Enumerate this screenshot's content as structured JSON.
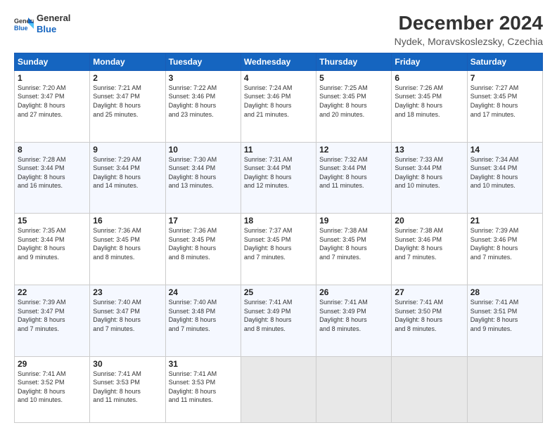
{
  "logo": {
    "line1": "General",
    "line2": "Blue"
  },
  "title": "December 2024",
  "subtitle": "Nydek, Moravskoslezsky, Czechia",
  "days_header": [
    "Sunday",
    "Monday",
    "Tuesday",
    "Wednesday",
    "Thursday",
    "Friday",
    "Saturday"
  ],
  "weeks": [
    [
      {
        "day": "1",
        "info": "Sunrise: 7:20 AM\nSunset: 3:47 PM\nDaylight: 8 hours\nand 27 minutes."
      },
      {
        "day": "2",
        "info": "Sunrise: 7:21 AM\nSunset: 3:47 PM\nDaylight: 8 hours\nand 25 minutes."
      },
      {
        "day": "3",
        "info": "Sunrise: 7:22 AM\nSunset: 3:46 PM\nDaylight: 8 hours\nand 23 minutes."
      },
      {
        "day": "4",
        "info": "Sunrise: 7:24 AM\nSunset: 3:46 PM\nDaylight: 8 hours\nand 21 minutes."
      },
      {
        "day": "5",
        "info": "Sunrise: 7:25 AM\nSunset: 3:45 PM\nDaylight: 8 hours\nand 20 minutes."
      },
      {
        "day": "6",
        "info": "Sunrise: 7:26 AM\nSunset: 3:45 PM\nDaylight: 8 hours\nand 18 minutes."
      },
      {
        "day": "7",
        "info": "Sunrise: 7:27 AM\nSunset: 3:45 PM\nDaylight: 8 hours\nand 17 minutes."
      }
    ],
    [
      {
        "day": "8",
        "info": "Sunrise: 7:28 AM\nSunset: 3:44 PM\nDaylight: 8 hours\nand 16 minutes."
      },
      {
        "day": "9",
        "info": "Sunrise: 7:29 AM\nSunset: 3:44 PM\nDaylight: 8 hours\nand 14 minutes."
      },
      {
        "day": "10",
        "info": "Sunrise: 7:30 AM\nSunset: 3:44 PM\nDaylight: 8 hours\nand 13 minutes."
      },
      {
        "day": "11",
        "info": "Sunrise: 7:31 AM\nSunset: 3:44 PM\nDaylight: 8 hours\nand 12 minutes."
      },
      {
        "day": "12",
        "info": "Sunrise: 7:32 AM\nSunset: 3:44 PM\nDaylight: 8 hours\nand 11 minutes."
      },
      {
        "day": "13",
        "info": "Sunrise: 7:33 AM\nSunset: 3:44 PM\nDaylight: 8 hours\nand 10 minutes."
      },
      {
        "day": "14",
        "info": "Sunrise: 7:34 AM\nSunset: 3:44 PM\nDaylight: 8 hours\nand 10 minutes."
      }
    ],
    [
      {
        "day": "15",
        "info": "Sunrise: 7:35 AM\nSunset: 3:44 PM\nDaylight: 8 hours\nand 9 minutes."
      },
      {
        "day": "16",
        "info": "Sunrise: 7:36 AM\nSunset: 3:45 PM\nDaylight: 8 hours\nand 8 minutes."
      },
      {
        "day": "17",
        "info": "Sunrise: 7:36 AM\nSunset: 3:45 PM\nDaylight: 8 hours\nand 8 minutes."
      },
      {
        "day": "18",
        "info": "Sunrise: 7:37 AM\nSunset: 3:45 PM\nDaylight: 8 hours\nand 7 minutes."
      },
      {
        "day": "19",
        "info": "Sunrise: 7:38 AM\nSunset: 3:45 PM\nDaylight: 8 hours\nand 7 minutes."
      },
      {
        "day": "20",
        "info": "Sunrise: 7:38 AM\nSunset: 3:46 PM\nDaylight: 8 hours\nand 7 minutes."
      },
      {
        "day": "21",
        "info": "Sunrise: 7:39 AM\nSunset: 3:46 PM\nDaylight: 8 hours\nand 7 minutes."
      }
    ],
    [
      {
        "day": "22",
        "info": "Sunrise: 7:39 AM\nSunset: 3:47 PM\nDaylight: 8 hours\nand 7 minutes."
      },
      {
        "day": "23",
        "info": "Sunrise: 7:40 AM\nSunset: 3:47 PM\nDaylight: 8 hours\nand 7 minutes."
      },
      {
        "day": "24",
        "info": "Sunrise: 7:40 AM\nSunset: 3:48 PM\nDaylight: 8 hours\nand 7 minutes."
      },
      {
        "day": "25",
        "info": "Sunrise: 7:41 AM\nSunset: 3:49 PM\nDaylight: 8 hours\nand 8 minutes."
      },
      {
        "day": "26",
        "info": "Sunrise: 7:41 AM\nSunset: 3:49 PM\nDaylight: 8 hours\nand 8 minutes."
      },
      {
        "day": "27",
        "info": "Sunrise: 7:41 AM\nSunset: 3:50 PM\nDaylight: 8 hours\nand 8 minutes."
      },
      {
        "day": "28",
        "info": "Sunrise: 7:41 AM\nSunset: 3:51 PM\nDaylight: 8 hours\nand 9 minutes."
      }
    ],
    [
      {
        "day": "29",
        "info": "Sunrise: 7:41 AM\nSunset: 3:52 PM\nDaylight: 8 hours\nand 10 minutes."
      },
      {
        "day": "30",
        "info": "Sunrise: 7:41 AM\nSunset: 3:53 PM\nDaylight: 8 hours\nand 11 minutes."
      },
      {
        "day": "31",
        "info": "Sunrise: 7:41 AM\nSunset: 3:53 PM\nDaylight: 8 hours\nand 11 minutes."
      },
      null,
      null,
      null,
      null
    ]
  ]
}
